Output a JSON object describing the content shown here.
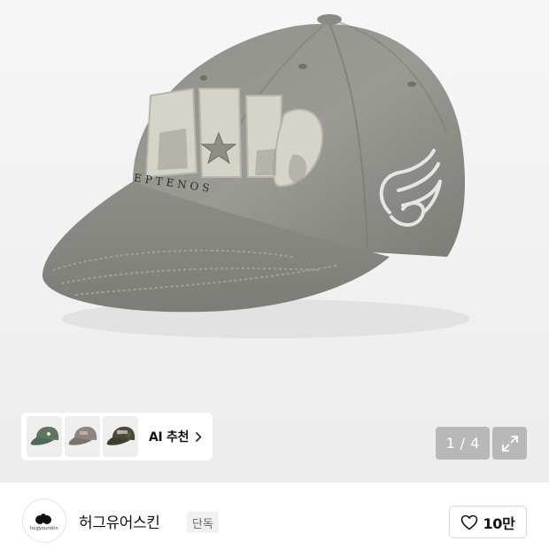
{
  "gallery": {
    "image_description_icon": "baseball-cap-photo",
    "ai_recommend": {
      "label": "AI 추천",
      "thumbnails": [
        {
          "icon": "green-cap-thumbnail",
          "color": "#5e7660"
        },
        {
          "icon": "brown-cap-thumbnail",
          "color": "#8f8580"
        },
        {
          "icon": "camo-cap-thumbnail",
          "color": "#4a4a3a"
        }
      ]
    },
    "pagination": {
      "current": "1",
      "separator": "/",
      "total": "4"
    },
    "expand_icon": "expand-arrows-icon"
  },
  "brand": {
    "logo_text": "hugyourskin",
    "name": "허그유어스킨",
    "badge": "단독"
  },
  "like": {
    "icon": "heart-outline-icon",
    "count": "10만"
  }
}
